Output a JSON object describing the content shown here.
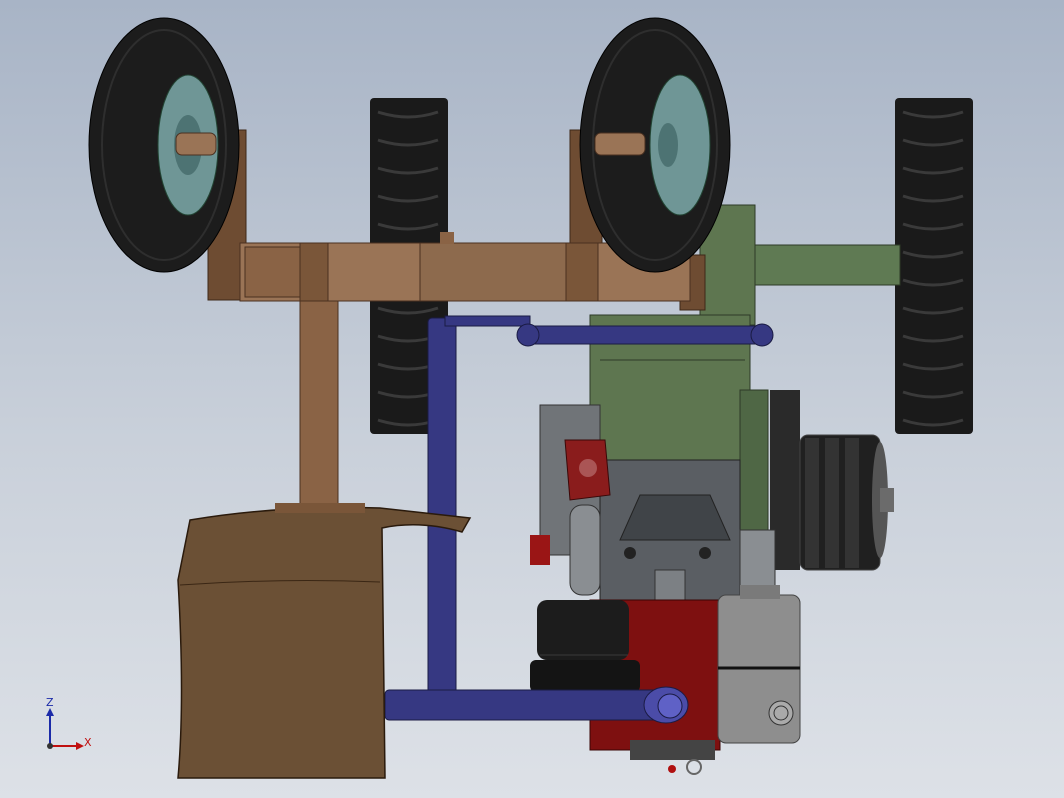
{
  "triad": {
    "z_label": "Z",
    "x_label": "X",
    "z_color": "#1b2aa8",
    "x_color": "#c01010"
  },
  "colors": {
    "background_top": "#a8b4c6",
    "background_bottom": "#dde1e7",
    "frame": "#8a6345",
    "frame_dark": "#6e4c32",
    "pipe": "#363882",
    "gearbox": "#5e7650",
    "engine_red": "#7e1010",
    "tire": "#1c1c1c",
    "hub": "#6f9696",
    "plough": "#6b5035",
    "filter": "#8e8e8e"
  }
}
